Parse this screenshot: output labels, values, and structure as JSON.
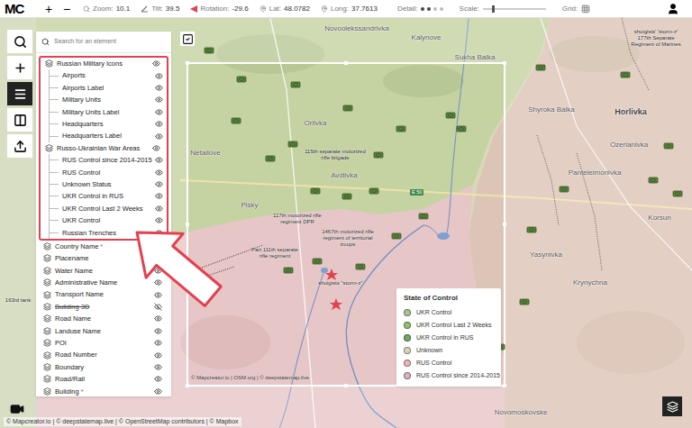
{
  "toolbar": {
    "logo": "MC",
    "zoom_in": "+",
    "zoom_out": "−",
    "fields": [
      {
        "label": "Zoom:",
        "value": "10.1"
      },
      {
        "label": "Tilt:",
        "value": "39.5"
      },
      {
        "label": "Rotation:",
        "value": "-29.6"
      },
      {
        "label": "Lat:",
        "value": "48.0782"
      },
      {
        "label": "Long:",
        "value": "37.7613"
      }
    ],
    "detail": {
      "label": "Detail:",
      "level": 0.5
    },
    "scale": {
      "label": "Scale:",
      "level": 0.15
    },
    "grid": {
      "label": "Grid:"
    }
  },
  "toolrail": [
    {
      "selected": false
    },
    {
      "selected": false
    },
    {
      "selected": true
    },
    {
      "selected": false
    },
    {
      "selected": false
    }
  ],
  "search": {
    "placeholder": "Search for an element"
  },
  "layers": [
    {
      "label": "Russian Military Icons",
      "kind": "group",
      "visible": true,
      "disabled": false,
      "highlighted": true,
      "children": [
        {
          "label": "Airports",
          "visible": true
        },
        {
          "label": "Airports Label",
          "visible": true
        },
        {
          "label": "Military Units",
          "visible": true
        },
        {
          "label": "Military Units Label",
          "visible": true
        },
        {
          "label": "Headquarters",
          "visible": true
        },
        {
          "label": "Headquarters Label",
          "visible": true
        }
      ]
    },
    {
      "label": "Russo-Ukrainian War Areas",
      "kind": "group",
      "visible": true,
      "disabled": false,
      "highlighted": true,
      "children": [
        {
          "label": "RUS Control since 2014-2015",
          "visible": true
        },
        {
          "label": "RUS Control",
          "visible": true
        },
        {
          "label": "Unknown Status",
          "visible": true
        },
        {
          "label": "UKR Control in RUS",
          "visible": true
        },
        {
          "label": "UKR Control Last 2 Weeks",
          "visible": true
        },
        {
          "label": "UKR Control",
          "visible": true
        },
        {
          "label": "Russian Trenches",
          "visible": true
        }
      ]
    },
    {
      "label": "Country Name",
      "kind": "layer",
      "visible": true,
      "disabled": false,
      "highlighted": false,
      "marker": "*"
    },
    {
      "label": "Placename",
      "kind": "layer",
      "visible": true,
      "disabled": false,
      "highlighted": false
    },
    {
      "label": "Water Name",
      "kind": "layer",
      "visible": true,
      "disabled": false,
      "highlighted": false
    },
    {
      "label": "Administrative Name",
      "kind": "layer",
      "visible": true,
      "disabled": false,
      "highlighted": false
    },
    {
      "label": "Transport Name",
      "kind": "layer",
      "visible": true,
      "disabled": false,
      "highlighted": false
    },
    {
      "label": "Building 3D",
      "kind": "layer",
      "visible": false,
      "disabled": true,
      "highlighted": false
    },
    {
      "label": "Road Name",
      "kind": "layer",
      "visible": true,
      "disabled": false,
      "highlighted": false
    },
    {
      "label": "Landuse Name",
      "kind": "layer",
      "visible": true,
      "disabled": false,
      "highlighted": false
    },
    {
      "label": "POI",
      "kind": "layer",
      "visible": true,
      "disabled": false,
      "highlighted": false
    },
    {
      "label": "Road Number",
      "kind": "layer",
      "visible": true,
      "disabled": false,
      "highlighted": false
    },
    {
      "label": "Boundary",
      "kind": "layer",
      "visible": true,
      "disabled": false,
      "highlighted": false
    },
    {
      "label": "Road/Rail",
      "kind": "layer",
      "visible": true,
      "disabled": false,
      "highlighted": false
    },
    {
      "label": "Building",
      "kind": "layer",
      "visible": true,
      "disabled": false,
      "highlighted": false,
      "marker": "*"
    }
  ],
  "map": {
    "places": [
      {
        "label": "Novoolekssandrivka",
        "kind": "town"
      },
      {
        "label": "Kalynove",
        "kind": "town"
      },
      {
        "label": "Sukha Balka",
        "kind": "town"
      },
      {
        "label": "shoigists' 'storm-z' 177th Separate Regiment of Marines",
        "kind": "unit"
      },
      {
        "label": "Orlivka",
        "kind": "town"
      },
      {
        "label": "115th separate motorized rifle brigade",
        "kind": "unit"
      },
      {
        "label": "Avdiivka",
        "kind": "town"
      },
      {
        "label": "Netailove",
        "kind": "town"
      },
      {
        "label": "Pisky",
        "kind": "town"
      },
      {
        "label": "117th motorized rifle regiment DPR",
        "kind": "unit"
      },
      {
        "label": "1467th motorized rifle regiment of territorial troops",
        "kind": "unit"
      },
      {
        "label": "Part 111th separate rifle regiment",
        "kind": "unit"
      },
      {
        "label": "shoigists \"storm-z\"",
        "kind": "unit"
      },
      {
        "label": "Shyroka Balka",
        "kind": "town"
      },
      {
        "label": "Horlivka",
        "kind": "city"
      },
      {
        "label": "Ozerianivka",
        "kind": "town"
      },
      {
        "label": "Panteleimonivka",
        "kind": "town"
      },
      {
        "label": "Korsun",
        "kind": "town"
      },
      {
        "label": "Yasynivka",
        "kind": "town"
      },
      {
        "label": "Krynychna",
        "kind": "town"
      },
      {
        "label": "Novomoskovske",
        "kind": "town"
      },
      {
        "label": "163rd tank",
        "kind": "unit"
      }
    ],
    "road_label": "E 50",
    "inner_attribution": "© Mapcreator.io | OSM.org | © deepstatemap.live"
  },
  "legend": {
    "title": "State of Control",
    "items": [
      {
        "label": "UKR Control",
        "color": "#a9c58e"
      },
      {
        "label": "UKR Control Last 2 Weeks",
        "color": "#8fbf72"
      },
      {
        "label": "UKR Control in RUS",
        "color": "#6fa868"
      },
      {
        "label": "Unknown",
        "color": "#d9d3bb"
      },
      {
        "label": "RUS Control",
        "color": "#eab6b6"
      },
      {
        "label": "RUS Control since 2014-2015",
        "color": "#d9b0c2"
      }
    ]
  },
  "attribution": "© Mapcreator.io | © deepstatemap.live | © OpenStreetMap contributors | © Mapbox"
}
